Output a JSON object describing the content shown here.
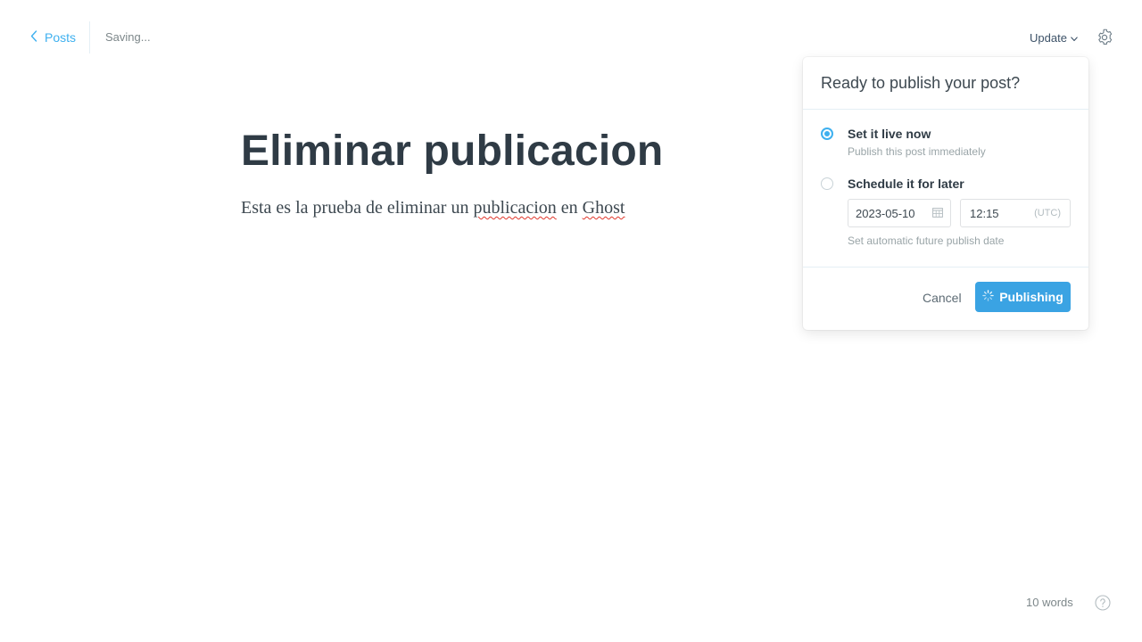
{
  "topbar": {
    "back_label": "Posts",
    "save_status": "Saving...",
    "update_label": "Update"
  },
  "editor": {
    "title": "Eliminar publicacion",
    "body_parts": {
      "p1": "Esta es la prueba de eliminar un ",
      "p2": "publicacion",
      "p3": " en ",
      "p4": "Ghost"
    }
  },
  "publish_popover": {
    "heading": "Ready to publish your post?",
    "option_now": {
      "label": "Set it live now",
      "description": "Publish this post immediately",
      "selected": true
    },
    "option_later": {
      "label": "Schedule it for later",
      "date": "2023-05-10",
      "time": "12:15",
      "timezone": "(UTC)",
      "hint": "Set automatic future publish date",
      "selected": false
    },
    "cancel_label": "Cancel",
    "publish_label": "Publishing"
  },
  "footer": {
    "word_count": "10 words"
  },
  "colors": {
    "accent": "#3eb0ef",
    "publish_button": "#3aa3e3",
    "title_text": "#2f3b45",
    "spellcheck": "#e0362b"
  },
  "icons": [
    "chevron-left-icon",
    "chevron-down-icon",
    "gear-icon",
    "calendar-icon",
    "spinner-icon",
    "help-icon"
  ]
}
